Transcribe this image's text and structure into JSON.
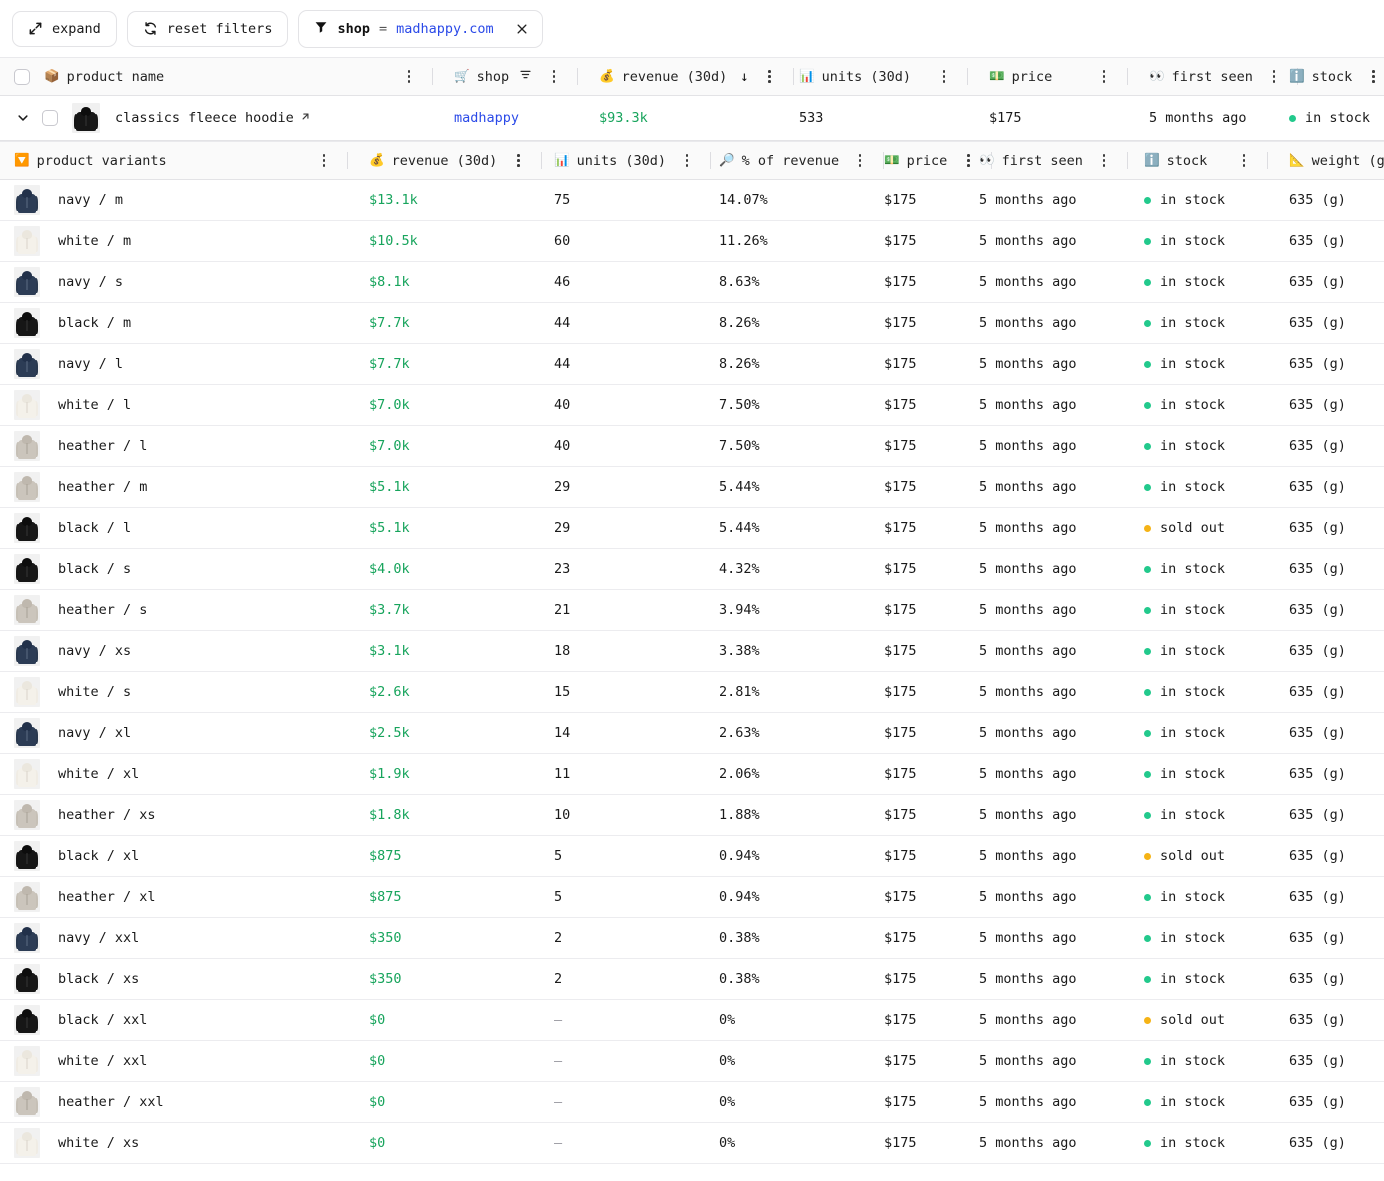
{
  "toolbar": {
    "expand_label": "expand",
    "reset_label": "reset filters",
    "filter": {
      "key": "shop",
      "operator": "=",
      "value": "madhappy.com",
      "clear_label": "×"
    }
  },
  "product_table": {
    "columns": [
      {
        "id": "product_name",
        "label": "product name",
        "icon": "📦",
        "icon_name": "package-icon"
      },
      {
        "id": "shop",
        "label": "shop",
        "icon": "🛒",
        "icon_name": "shopping-cart-icon",
        "has_filter_icon": true
      },
      {
        "id": "revenue_30d",
        "label": "revenue (30d)",
        "icon": "💰",
        "icon_name": "money-bag-icon",
        "sort": "desc",
        "sort_glyph": "↓"
      },
      {
        "id": "units_30d",
        "label": "units (30d)",
        "icon": "📊",
        "icon_name": "bar-chart-icon"
      },
      {
        "id": "price",
        "label": "price",
        "icon": "💵",
        "icon_name": "dollar-banknote-icon"
      },
      {
        "id": "first_seen",
        "label": "first seen",
        "icon": "👀",
        "icon_name": "eyes-icon"
      },
      {
        "id": "stock",
        "label": "stock",
        "icon": "ℹ️",
        "icon_name": "info-icon"
      }
    ],
    "row": {
      "name": "classics fleece hoodie",
      "shop": "madhappy",
      "revenue_30d": "$93.3k",
      "units_30d": "533",
      "price": "$175",
      "first_seen": "5 months ago",
      "stock": "in stock",
      "stock_state": "in-stock",
      "thumb_color": "#1b1b1b"
    }
  },
  "variants_table": {
    "title": "product variants",
    "title_icon": "🔽",
    "columns": [
      {
        "id": "variant",
        "label": "product variants",
        "icon": "🔽",
        "icon_name": "down-arrow-tray-icon"
      },
      {
        "id": "revenue_30d",
        "label": "revenue (30d)",
        "icon": "💰",
        "icon_name": "money-bag-icon"
      },
      {
        "id": "units_30d",
        "label": "units (30d)",
        "icon": "📊",
        "icon_name": "bar-chart-icon"
      },
      {
        "id": "pct_of_revenue",
        "label": "% of revenue",
        "icon": "🔎",
        "icon_name": "magnifier-icon"
      },
      {
        "id": "price",
        "label": "price",
        "icon": "💵",
        "icon_name": "dollar-banknote-icon"
      },
      {
        "id": "first_seen",
        "label": "first seen",
        "icon": "👀",
        "icon_name": "eyes-icon"
      },
      {
        "id": "stock",
        "label": "stock",
        "icon": "ℹ️",
        "icon_name": "info-icon"
      },
      {
        "id": "weight_g",
        "label": "weight (g)",
        "icon": "📐",
        "icon_name": "triangular-ruler-icon"
      }
    ],
    "rows": [
      {
        "variant": "navy / m",
        "color": "navy",
        "revenue": "$13.1k",
        "units": "75",
        "pct": "14.07%",
        "price": "$175",
        "first_seen": "5 months ago",
        "stock": "in stock",
        "stock_state": "in-stock",
        "weight": "635 (g)"
      },
      {
        "variant": "white / m",
        "color": "white",
        "revenue": "$10.5k",
        "units": "60",
        "pct": "11.26%",
        "price": "$175",
        "first_seen": "5 months ago",
        "stock": "in stock",
        "stock_state": "in-stock",
        "weight": "635 (g)"
      },
      {
        "variant": "navy / s",
        "color": "navy",
        "revenue": "$8.1k",
        "units": "46",
        "pct": "8.63%",
        "price": "$175",
        "first_seen": "5 months ago",
        "stock": "in stock",
        "stock_state": "in-stock",
        "weight": "635 (g)"
      },
      {
        "variant": "black / m",
        "color": "black",
        "revenue": "$7.7k",
        "units": "44",
        "pct": "8.26%",
        "price": "$175",
        "first_seen": "5 months ago",
        "stock": "in stock",
        "stock_state": "in-stock",
        "weight": "635 (g)"
      },
      {
        "variant": "navy / l",
        "color": "navy",
        "revenue": "$7.7k",
        "units": "44",
        "pct": "8.26%",
        "price": "$175",
        "first_seen": "5 months ago",
        "stock": "in stock",
        "stock_state": "in-stock",
        "weight": "635 (g)"
      },
      {
        "variant": "white / l",
        "color": "white",
        "revenue": "$7.0k",
        "units": "40",
        "pct": "7.50%",
        "price": "$175",
        "first_seen": "5 months ago",
        "stock": "in stock",
        "stock_state": "in-stock",
        "weight": "635 (g)"
      },
      {
        "variant": "heather / l",
        "color": "heather",
        "revenue": "$7.0k",
        "units": "40",
        "pct": "7.50%",
        "price": "$175",
        "first_seen": "5 months ago",
        "stock": "in stock",
        "stock_state": "in-stock",
        "weight": "635 (g)"
      },
      {
        "variant": "heather / m",
        "color": "heather",
        "revenue": "$5.1k",
        "units": "29",
        "pct": "5.44%",
        "price": "$175",
        "first_seen": "5 months ago",
        "stock": "in stock",
        "stock_state": "in-stock",
        "weight": "635 (g)"
      },
      {
        "variant": "black / l",
        "color": "black",
        "revenue": "$5.1k",
        "units": "29",
        "pct": "5.44%",
        "price": "$175",
        "first_seen": "5 months ago",
        "stock": "sold out",
        "stock_state": "sold-out",
        "weight": "635 (g)"
      },
      {
        "variant": "black / s",
        "color": "black",
        "revenue": "$4.0k",
        "units": "23",
        "pct": "4.32%",
        "price": "$175",
        "first_seen": "5 months ago",
        "stock": "in stock",
        "stock_state": "in-stock",
        "weight": "635 (g)"
      },
      {
        "variant": "heather / s",
        "color": "heather",
        "revenue": "$3.7k",
        "units": "21",
        "pct": "3.94%",
        "price": "$175",
        "first_seen": "5 months ago",
        "stock": "in stock",
        "stock_state": "in-stock",
        "weight": "635 (g)"
      },
      {
        "variant": "navy / xs",
        "color": "navy",
        "revenue": "$3.1k",
        "units": "18",
        "pct": "3.38%",
        "price": "$175",
        "first_seen": "5 months ago",
        "stock": "in stock",
        "stock_state": "in-stock",
        "weight": "635 (g)"
      },
      {
        "variant": "white / s",
        "color": "white",
        "revenue": "$2.6k",
        "units": "15",
        "pct": "2.81%",
        "price": "$175",
        "first_seen": "5 months ago",
        "stock": "in stock",
        "stock_state": "in-stock",
        "weight": "635 (g)"
      },
      {
        "variant": "navy / xl",
        "color": "navy",
        "revenue": "$2.5k",
        "units": "14",
        "pct": "2.63%",
        "price": "$175",
        "first_seen": "5 months ago",
        "stock": "in stock",
        "stock_state": "in-stock",
        "weight": "635 (g)"
      },
      {
        "variant": "white / xl",
        "color": "white",
        "revenue": "$1.9k",
        "units": "11",
        "pct": "2.06%",
        "price": "$175",
        "first_seen": "5 months ago",
        "stock": "in stock",
        "stock_state": "in-stock",
        "weight": "635 (g)"
      },
      {
        "variant": "heather / xs",
        "color": "heather",
        "revenue": "$1.8k",
        "units": "10",
        "pct": "1.88%",
        "price": "$175",
        "first_seen": "5 months ago",
        "stock": "in stock",
        "stock_state": "in-stock",
        "weight": "635 (g)"
      },
      {
        "variant": "black / xl",
        "color": "black",
        "revenue": "$875",
        "units": "5",
        "pct": "0.94%",
        "price": "$175",
        "first_seen": "5 months ago",
        "stock": "sold out",
        "stock_state": "sold-out",
        "weight": "635 (g)"
      },
      {
        "variant": "heather / xl",
        "color": "heather",
        "revenue": "$875",
        "units": "5",
        "pct": "0.94%",
        "price": "$175",
        "first_seen": "5 months ago",
        "stock": "in stock",
        "stock_state": "in-stock",
        "weight": "635 (g)"
      },
      {
        "variant": "navy / xxl",
        "color": "navy",
        "revenue": "$350",
        "units": "2",
        "pct": "0.38%",
        "price": "$175",
        "first_seen": "5 months ago",
        "stock": "in stock",
        "stock_state": "in-stock",
        "weight": "635 (g)"
      },
      {
        "variant": "black / xs",
        "color": "black",
        "revenue": "$350",
        "units": "2",
        "pct": "0.38%",
        "price": "$175",
        "first_seen": "5 months ago",
        "stock": "in stock",
        "stock_state": "in-stock",
        "weight": "635 (g)"
      },
      {
        "variant": "black / xxl",
        "color": "black",
        "revenue": "$0",
        "units": "–",
        "pct": "0%",
        "price": "$175",
        "first_seen": "5 months ago",
        "stock": "sold out",
        "stock_state": "sold-out",
        "weight": "635 (g)"
      },
      {
        "variant": "white / xxl",
        "color": "white",
        "revenue": "$0",
        "units": "–",
        "pct": "0%",
        "price": "$175",
        "first_seen": "5 months ago",
        "stock": "in stock",
        "stock_state": "in-stock",
        "weight": "635 (g)"
      },
      {
        "variant": "heather / xxl",
        "color": "heather",
        "revenue": "$0",
        "units": "–",
        "pct": "0%",
        "price": "$175",
        "first_seen": "5 months ago",
        "stock": "in stock",
        "stock_state": "in-stock",
        "weight": "635 (g)"
      },
      {
        "variant": "white / xs",
        "color": "white",
        "revenue": "$0",
        "units": "–",
        "pct": "0%",
        "price": "$175",
        "first_seen": "5 months ago",
        "stock": "in stock",
        "stock_state": "in-stock",
        "weight": "635 (g)"
      }
    ]
  },
  "colors": {
    "revenue_green": "#17a45c",
    "link_blue": "#2b4ae8",
    "in_stock_dot": "#22c98c",
    "sold_out_dot": "#f5b316",
    "muted": "#9a9aa2",
    "swatch_navy": "#2b3a52",
    "swatch_white": "#f2efe9",
    "swatch_black": "#121212",
    "swatch_heather": "#c9c3bb"
  }
}
